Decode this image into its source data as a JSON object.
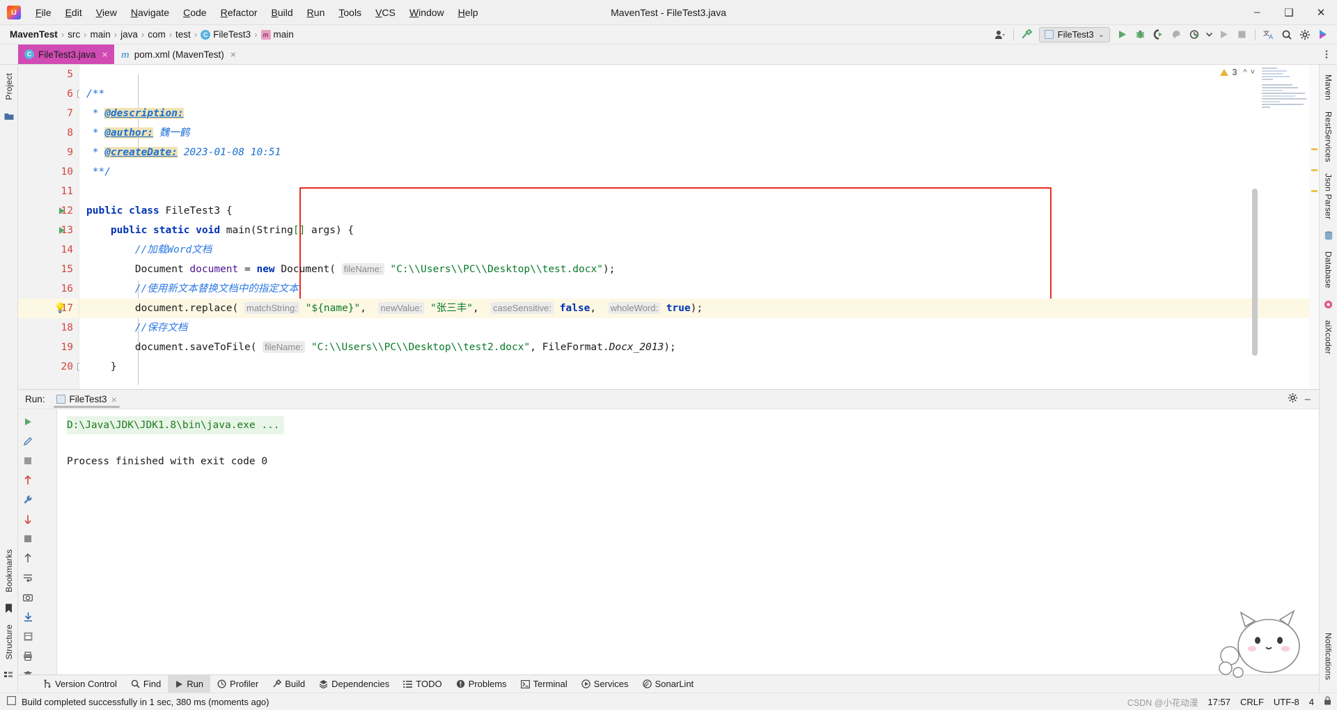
{
  "titlebar": {
    "window_title": "MavenTest - FileTest3.java",
    "logo": "intellij-idea-logo",
    "menus": [
      "File",
      "Edit",
      "View",
      "Navigate",
      "Code",
      "Refactor",
      "Build",
      "Run",
      "Tools",
      "VCS",
      "Window",
      "Help"
    ],
    "minimize": "–",
    "maximize": "❑",
    "close": "✕"
  },
  "navbar": {
    "crumbs": [
      "MavenTest",
      "src",
      "main",
      "java",
      "com",
      "test",
      "FileTest3",
      "main"
    ],
    "separator": "›",
    "class_icon_letter": "C",
    "method_icon_letter": "m",
    "run_config": {
      "name": "FileTest3",
      "chevron": "⌄"
    },
    "icons": [
      "user-avatar-icon",
      "hammer-build-icon",
      "run-icon",
      "debug-icon",
      "run-coverage-icon",
      "profiler-icon",
      "run-with-profiler-icon",
      "stop-icon",
      "translate-icon",
      "search-everywhere-icon",
      "settings-gear-icon",
      "updates-icon"
    ]
  },
  "tabs": [
    {
      "label": "FileTest3.java",
      "icon": "java-class-icon",
      "active": true,
      "close": "×"
    },
    {
      "label": "pom.xml (MavenTest)",
      "icon": "maven-icon",
      "active": false,
      "close": "×"
    }
  ],
  "left_rail": {
    "items": [
      "Project",
      "Bookmarks",
      "Structure"
    ]
  },
  "right_rail": {
    "items": [
      "Maven",
      "RestServices",
      "Json Parser",
      "Database",
      "aiXcoder",
      "Notifications"
    ]
  },
  "editor": {
    "inspection_warnings": "3",
    "lines": [
      {
        "num": "5",
        "text": ""
      },
      {
        "num": "6",
        "text": "/**",
        "fold": true
      },
      {
        "num": "7",
        "text": " * @description:"
      },
      {
        "num": "8",
        "text": " * @author: 魏一鹤"
      },
      {
        "num": "9",
        "text": " * @createDate: 2023-01-08 10:51"
      },
      {
        "num": "10",
        "text": " **/"
      },
      {
        "num": "11",
        "text": ""
      },
      {
        "num": "12",
        "text": "public class FileTest3 {",
        "runnable": true
      },
      {
        "num": "13",
        "text": "    public static void main(String[] args) {",
        "runnable": true
      },
      {
        "num": "14",
        "text": "        //加载Word文档"
      },
      {
        "num": "15",
        "text": "        Document document = new Document( fileName: \"C:\\\\Users\\\\PC\\\\Desktop\\\\test.docx\");"
      },
      {
        "num": "16",
        "text": "        //使用新文本替换文档中的指定文本"
      },
      {
        "num": "17",
        "text": "        document.replace( matchString: \"${name}\",  newValue: \"张三丰\",  caseSensitive: false,  wholeWord: true);",
        "current": true,
        "bulb": true
      },
      {
        "num": "18",
        "text": "        //保存文档"
      },
      {
        "num": "19",
        "text": "        document.saveToFile( fileName: \"C:\\\\Users\\\\PC\\\\Desktop\\\\test2.docx\", FileFormat.Docx_2013);"
      },
      {
        "num": "20",
        "text": "    }",
        "fold": true
      }
    ],
    "doc_tags": {
      "description": "@description:",
      "author_tag": "@author:",
      "author_value": "魏一鹤",
      "date_tag": "@createDate:",
      "date_value": "2023-01-08 10:51"
    },
    "code_tokens": {
      "comment_load": "//加载Word文档",
      "comment_replace": "//使用新文本替换文档中的指定文本",
      "comment_save": "//保存文档",
      "hint_filename": "fileName:",
      "hint_matchstring": "matchString:",
      "hint_newvalue": "newValue:",
      "hint_casesensitive": "caseSensitive:",
      "hint_wholeword": "wholeWord:",
      "path_load": "\"C:\\\\Users\\\\PC\\\\Desktop\\\\test.docx\"",
      "path_save": "\"C:\\\\Users\\\\PC\\\\Desktop\\\\test2.docx\"",
      "match_string": "\"${name}\"",
      "new_value": "\"张三丰\"",
      "case_sensitive": "false",
      "whole_word": "true",
      "file_format": "FileFormat.",
      "file_format_const": "Docx_2013"
    },
    "highlight_box_color": "#e82b20"
  },
  "run_panel": {
    "label": "Run:",
    "tab_name": "FileTest3",
    "tab_close": "×",
    "console": [
      {
        "text": "D:\\Java\\JDK\\JDK1.8\\bin\\java.exe ...",
        "style": "command"
      },
      {
        "text": "",
        "style": "blank"
      },
      {
        "text": "Process finished with exit code 0",
        "style": "output"
      }
    ],
    "settings_icon": "gear-icon",
    "minimize_icon": "–",
    "rail_icons": [
      "rerun-icon",
      "edit-icon",
      "scroll-up-icon",
      "stop-icon",
      "scroll-down-icon",
      "wrench-icon",
      "print-icon",
      "camera-icon",
      "trash-icon",
      "soft-wrap-icon",
      "scroll-end-icon",
      "filter-icon",
      "export-icon"
    ]
  },
  "bottom_tools": [
    {
      "label": "Version Control",
      "icon": "branch-icon",
      "active": false
    },
    {
      "label": "Find",
      "icon": "search-icon",
      "active": false
    },
    {
      "label": "Run",
      "icon": "run-icon",
      "active": true
    },
    {
      "label": "Profiler",
      "icon": "profiler-icon",
      "active": false
    },
    {
      "label": "Build",
      "icon": "hammer-icon",
      "active": false
    },
    {
      "label": "Dependencies",
      "icon": "dependencies-icon",
      "active": false
    },
    {
      "label": "TODO",
      "icon": "todo-list-icon",
      "active": false
    },
    {
      "label": "Problems",
      "icon": "problems-icon",
      "active": false
    },
    {
      "label": "Terminal",
      "icon": "terminal-icon",
      "active": false
    },
    {
      "label": "Services",
      "icon": "services-icon",
      "active": false
    },
    {
      "label": "SonarLint",
      "icon": "sonarlint-icon",
      "active": false
    }
  ],
  "statusbar": {
    "message": "Build completed successfully in 1 sec, 380 ms (moments ago)",
    "message_icon": "build-status-icon",
    "time": "17:57",
    "line_separator": "CRLF",
    "encoding": "UTF-8",
    "indent": "4",
    "watermark": "CSDN @小花动漫"
  }
}
